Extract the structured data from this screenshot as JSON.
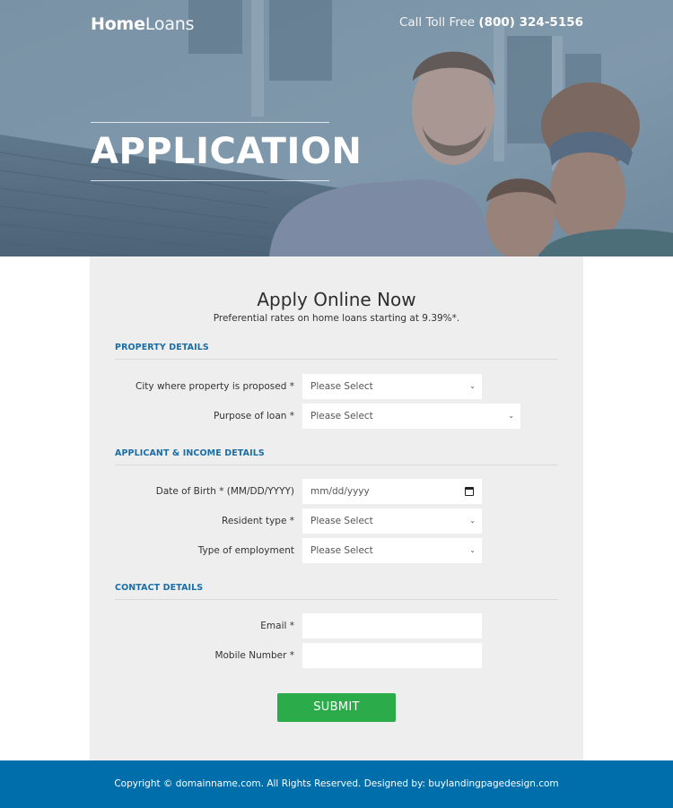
{
  "header": {
    "logo_bold": "Home",
    "logo_light": "Loans",
    "toll_label": "Call Toll Free",
    "toll_number": "(800) 324-5156",
    "hero_title": "APPLICATION"
  },
  "form": {
    "title": "Apply Online Now",
    "subtitle": "Preferential rates on home loans starting at 9.39%*.",
    "sections": [
      {
        "heading": "PROPERTY DETAILS",
        "fields": [
          {
            "label": "City where property is proposed *",
            "type": "select",
            "value": "Please Select"
          },
          {
            "label": "Purpose of loan *",
            "type": "select",
            "value": "Please Select"
          }
        ]
      },
      {
        "heading": "APPLICANT & INCOME DETAILS",
        "fields": [
          {
            "label": "Date of Birth * (MM/DD/YYYY)",
            "type": "date",
            "placeholder": "mm/dd/yyyy"
          },
          {
            "label": "Resident type *",
            "type": "select",
            "value": "Please Select"
          },
          {
            "label": "Type of employment",
            "type": "select",
            "value": "Please Select"
          }
        ]
      },
      {
        "heading": "CONTACT DETAILS",
        "fields": [
          {
            "label": "Email *",
            "type": "text",
            "value": ""
          },
          {
            "label": "Mobile Number *",
            "type": "text",
            "value": ""
          }
        ]
      }
    ],
    "submit_label": "SUBMIT"
  },
  "footer": {
    "text": "Copyright © domainname.com. All Rights Reserved. Designed by: buylandingpagedesign.com"
  },
  "icons": {
    "select_chevron": "chevron-down-icon",
    "date_picker": "calendar-icon"
  },
  "colors": {
    "accent_blue": "#1a6ea8",
    "footer_blue": "#006eab",
    "submit_green": "#2bab4a",
    "panel_bg": "#eeeeee"
  }
}
